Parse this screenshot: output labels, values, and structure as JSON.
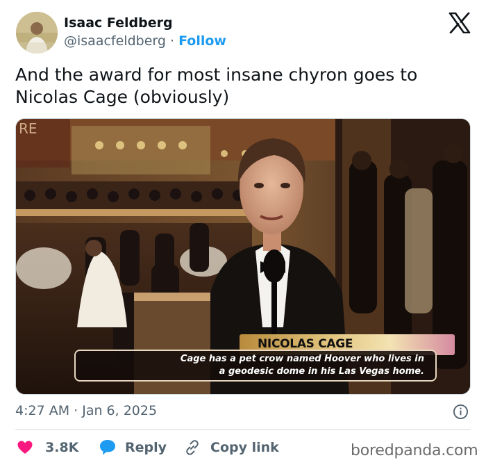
{
  "author": {
    "name": "Isaac Feldberg",
    "handle": "@isaacfeldberg",
    "separator": "·",
    "follow_label": "Follow",
    "avatar_icon": "avatar-photo"
  },
  "platform": {
    "logo_icon": "x-logo-icon"
  },
  "tweet": {
    "text_line1": "And the award for most insane chyron goes to",
    "text_line2": "Nicolas Cage (obviously)"
  },
  "media": {
    "corner_text": "RE",
    "chyron": {
      "name": "NICOLAS CAGE",
      "line1": "Cage has a pet crow named Hoover who lives in",
      "line2": "a geodesic dome in his Las Vegas home."
    }
  },
  "meta": {
    "timestamp": "4:27 AM · Jan 6, 2025",
    "info_icon": "info-icon"
  },
  "actions": {
    "likes": "3.8K",
    "reply_label": "Reply",
    "copy_label": "Copy link",
    "like_icon": "heart-icon",
    "reply_icon": "speech-bubble-icon",
    "copy_icon": "link-icon"
  },
  "watermark": "boredpanda.com",
  "colors": {
    "accent": "#1d9bf0",
    "like": "#f91880",
    "text_primary": "#0f1419",
    "text_secondary": "#536471"
  }
}
